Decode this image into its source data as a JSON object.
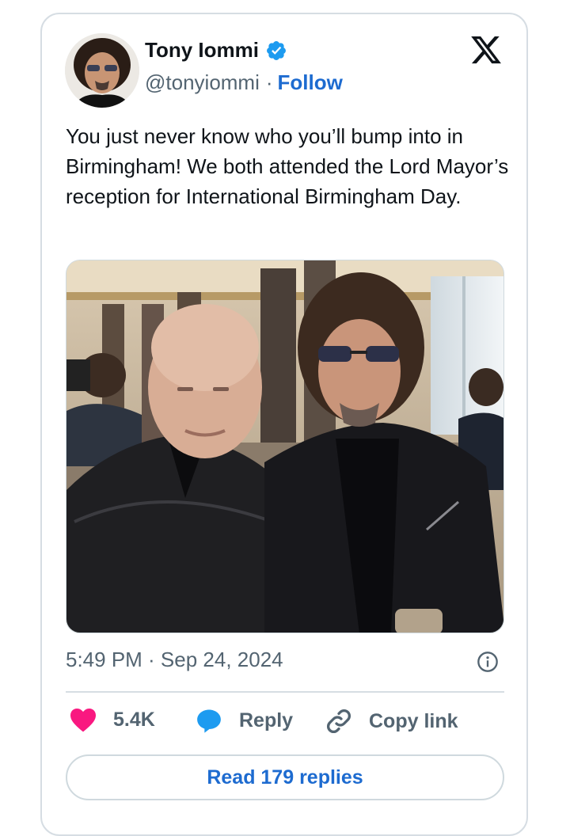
{
  "author": {
    "name": "Tony Iommi",
    "handle": "@tonyiommi",
    "separator": "·",
    "follow_label": "Follow"
  },
  "tweet": {
    "text": "You just never know who you’ll bump into in Birmingham! We both attended the Lord Mayor’s reception for International Birmingham Day.",
    "timestamp": "5:49 PM · Sep 24, 2024"
  },
  "actions": {
    "like_count": "5.4K",
    "reply_label": "Reply",
    "copy_link_label": "Copy link"
  },
  "read_replies_label": "Read 179 replies",
  "colors": {
    "link": "#1d6bd0",
    "like": "#f91880",
    "reply": "#1d9bf0",
    "muted": "#536471",
    "border": "#d6dde3"
  },
  "icons": {
    "logo": "x-logo-icon",
    "verified": "verified-badge-icon",
    "like": "heart-icon",
    "reply": "speech-bubble-icon",
    "copy": "link-icon",
    "info": "info-icon"
  }
}
